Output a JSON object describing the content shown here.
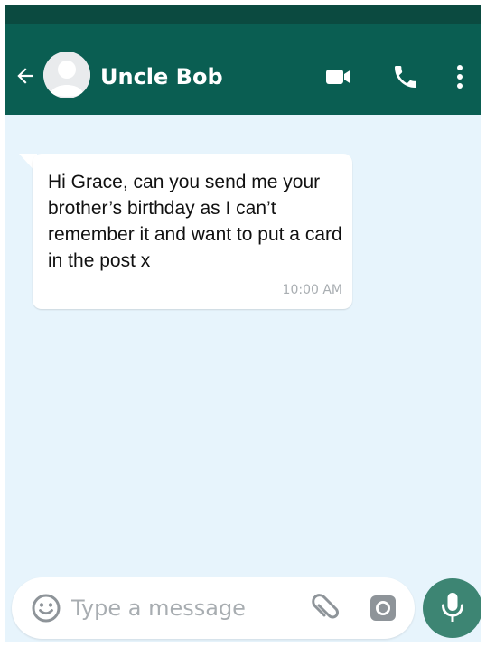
{
  "header": {
    "contact_name": "Uncle Bob",
    "back_icon": "arrow-left-icon",
    "video_icon": "video-camera-icon",
    "call_icon": "phone-icon",
    "menu_icon": "more-vertical-icon"
  },
  "messages": [
    {
      "direction": "incoming",
      "text": "Hi Grace, can you send me your brother’s birthday as I can’t remember it and want to put a card in the post x",
      "time": "10:00 AM"
    }
  ],
  "composer": {
    "placeholder": "Type a message",
    "value": "",
    "emoji_icon": "emoji-icon",
    "attach_icon": "paperclip-icon",
    "camera_icon": "camera-icon",
    "mic_icon": "microphone-icon"
  },
  "colors": {
    "app_bar": "#0a5e52",
    "status_bar": "#0b4a40",
    "chat_background": "#e7f4fc",
    "bubble": "#ffffff",
    "mic_button": "#3d8573"
  }
}
